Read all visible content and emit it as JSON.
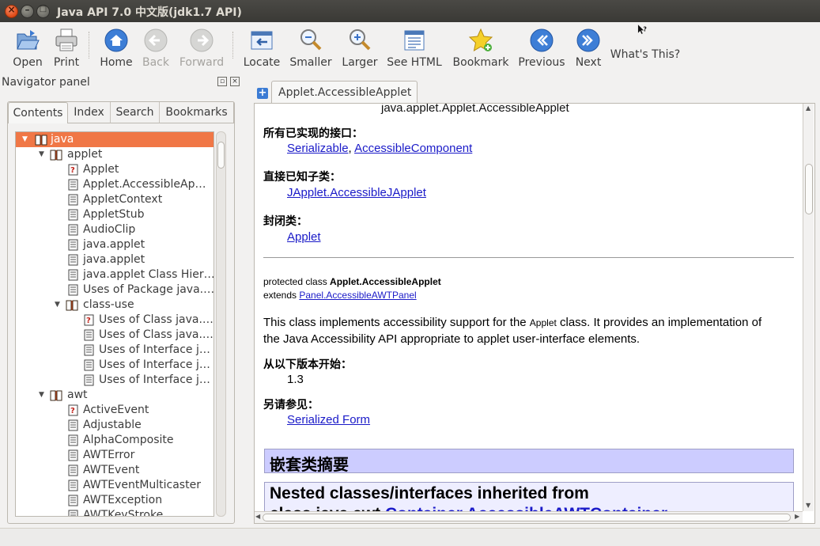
{
  "window": {
    "title": "Java API 7.0 中文版(jdk1.7 API)"
  },
  "toolbar": {
    "open": "Open",
    "print": "Print",
    "home": "Home",
    "back": "Back",
    "forward": "Forward",
    "locate": "Locate",
    "smaller": "Smaller",
    "larger": "Larger",
    "see_html": "See HTML",
    "bookmark": "Bookmark",
    "previous": "Previous",
    "next": "Next",
    "whats_this": "What's This?"
  },
  "navigator": {
    "title": "Navigator panel",
    "tabs": {
      "contents": "Contents",
      "index": "Index",
      "search": "Search",
      "bookmarks": "Bookmarks"
    },
    "tree": [
      "java",
      "applet",
      "Applet",
      "Applet.AccessibleAp…",
      "AppletContext",
      "AppletStub",
      "AudioClip",
      "java.applet",
      "java.applet",
      "java.applet Class Hier…",
      "Uses of Package java.…",
      "class-use",
      "Uses of Class java.…",
      "Uses of Class java.…",
      "Uses of Interface j…",
      "Uses of Interface j…",
      "Uses of Interface j…",
      "awt",
      "ActiveEvent",
      "Adjustable",
      "AlphaComposite",
      "AWTError",
      "AWTEvent",
      "AWTEventMulticaster",
      "AWTException",
      "AWTKeyStroke"
    ]
  },
  "content": {
    "tab_label": "Applet.AccessibleApplet",
    "top_line": "java.applet.Applet.AccessibleApplet",
    "impl_header": "所有已实现的接口：",
    "impl_links": [
      "Serializable",
      "AccessibleComponent"
    ],
    "sub_header": "直接已知子类：",
    "sub_link": "JApplet.AccessibleJApplet",
    "enclosing_header": "封闭类：",
    "enclosing_link": "Applet",
    "decl_prefix": "protected class ",
    "decl_name": "Applet.AccessibleApplet",
    "extends_label": "extends ",
    "extends_link": "Panel.AccessibleAWTPanel",
    "desc_1": "This class implements accessibility support for the ",
    "desc_code": "Applet",
    "desc_2": " class. It provides an implementation of",
    "desc_3": "the Java Accessibility API appropriate to applet user-interface elements.",
    "since_header": "从以下版本开始：",
    "since_value": "1.3",
    "see_header": "另请参见：",
    "see_link": "Serialized Form",
    "nested_summary": "嵌套类摘要",
    "nested_inherited_1": "Nested classes/interfaces inherited from",
    "nested_inherited_2_prefix": "class java.awt.",
    "nested_inherited_2_link": "Container.AccessibleAWTContainer"
  }
}
